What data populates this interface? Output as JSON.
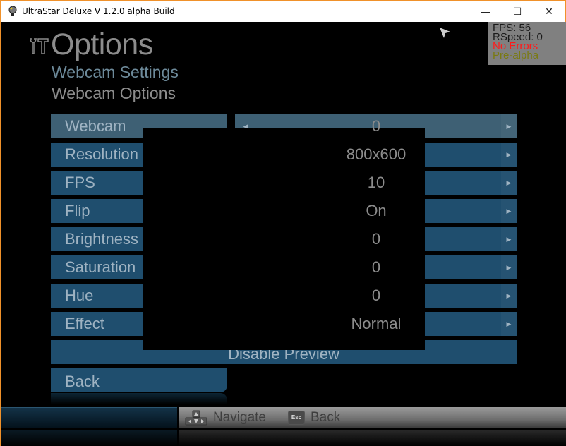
{
  "window": {
    "title": "UltraStar Deluxe V 1.2.0 alpha Build",
    "controls": {
      "minimize": "—",
      "maximize": "☐",
      "close": "✕"
    },
    "border_color": "#f0912a"
  },
  "header": {
    "icon": "tools-icon",
    "title": "Options",
    "subtitle": "Webcam Settings",
    "section": "Webcam Options"
  },
  "stats": {
    "fps": "FPS: 56",
    "rspeed": "RSpeed: 0",
    "errors": "No Errors",
    "version": "Pre-alpha"
  },
  "options": [
    {
      "label": "Webcam",
      "value": "0",
      "selected": true
    },
    {
      "label": "Resolution",
      "value": "800x600",
      "selected": false
    },
    {
      "label": "FPS",
      "value": "10",
      "selected": false
    },
    {
      "label": "Flip",
      "value": "On",
      "selected": false
    },
    {
      "label": "Brightness",
      "value": "0",
      "selected": false
    },
    {
      "label": "Saturation",
      "value": "0",
      "selected": false
    },
    {
      "label": "Hue",
      "value": "0",
      "selected": false
    },
    {
      "label": "Effect",
      "value": "Normal",
      "selected": false
    }
  ],
  "arrows": {
    "left": "◀",
    "right": "▶"
  },
  "buttons": {
    "disable_preview": "Disable Preview",
    "back": "Back"
  },
  "footer": {
    "navigate_key": "nav-keys",
    "navigate_label": "Navigate",
    "back_key": "Esc",
    "back_label": "Back"
  },
  "colors": {
    "button_bg": "#1f4e6e",
    "button_selected_bg": "#3e6074",
    "text": "#9fb3c2"
  }
}
